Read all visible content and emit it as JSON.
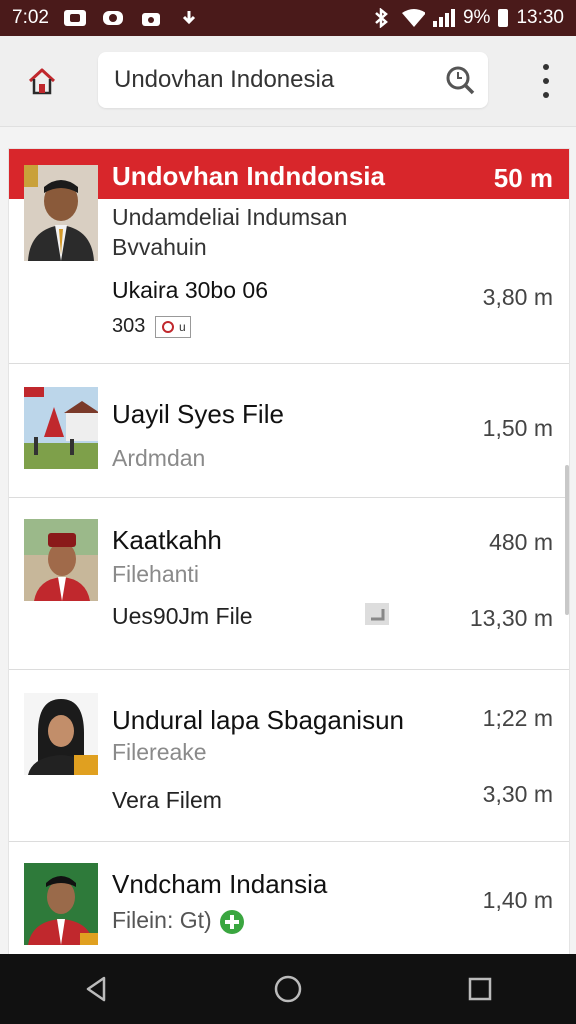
{
  "status_bar": {
    "time_left": "7:02",
    "battery_text": "9%",
    "time_right": "13:30"
  },
  "app_bar": {
    "search_value": "Undovhan Indonesia",
    "icons": {
      "home": "home-icon",
      "search": "search-icon",
      "more": "more-vert-icon"
    }
  },
  "list": {
    "items": [
      {
        "header_title": "Undovhan Indndonsia",
        "header_distance": "50 m",
        "line1": "Undamdeliai Indumsan",
        "line2": "Bvvahuin",
        "line3": "Ukaira 30bo 06",
        "line4": "303",
        "distance": "3,80 m"
      },
      {
        "title": "Uayil Syes File",
        "sub": "Ardmdan",
        "distance": "1,50 m"
      },
      {
        "title": "Kaatkahh",
        "sub": "Filehanti",
        "line3": "Ues90Jm File",
        "distance1": "480 m",
        "distance2": "13,30 m"
      },
      {
        "title": "Undural lapa Sbaganisun",
        "sub": "Filereake",
        "line3": "Vera Filem",
        "distance1": "1;22 m",
        "distance2": "3,30 m"
      },
      {
        "title": "Vndcham Indansia",
        "sub": "Filein: Gt)",
        "distance": "1,40 m"
      }
    ]
  },
  "colors": {
    "accent": "#d8262b",
    "status_bar": "#4a1a1a",
    "nav_bar": "#111111"
  }
}
